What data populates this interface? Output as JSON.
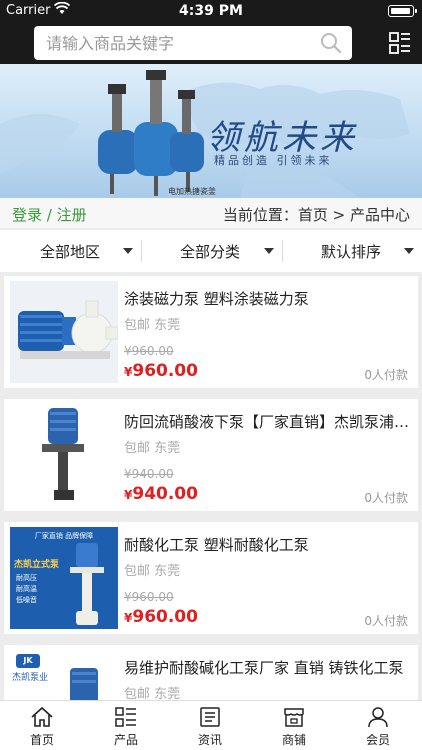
{
  "status_bar": {
    "carrier": "Carrier",
    "time": "4:39 PM"
  },
  "search": {
    "placeholder": "请输入商品关键字"
  },
  "banner": {
    "slogan": "领航未来",
    "subtitle": "精品创造 引领未来",
    "brand_text": "电加热搪瓷釜"
  },
  "crumbs": {
    "login": "登录 / 注册",
    "position": "当前位置：首页 > 产品中心"
  },
  "filters": [
    {
      "label": "全部地区"
    },
    {
      "label": "全部分类"
    },
    {
      "label": "默认排序"
    }
  ],
  "products": [
    {
      "title": "涂装磁力泵 塑料涂装磁力泵",
      "meta": "包邮 东莞",
      "old_price": "¥960.00",
      "currency": "¥",
      "price": "960.00",
      "paid": "0人付款"
    },
    {
      "title": "防回流硝酸液下泵【厂家直销】杰凯泵浦立式泵",
      "meta": "包邮 东莞",
      "old_price": "¥940.00",
      "currency": "¥",
      "price": "940.00",
      "paid": "0人付款"
    },
    {
      "title": "耐酸化工泵 塑料耐酸化工泵",
      "meta": "包邮 东莞",
      "old_price": "¥960.00",
      "currency": "¥",
      "price": "960.00",
      "paid": "0人付款",
      "image_text": {
        "top": "厂家直销 品牌保障",
        "heading": "杰凯立式泵",
        "lines": [
          "耐高压",
          "耐高温",
          "低噪音"
        ]
      }
    },
    {
      "title": "易维护耐酸碱化工泵厂家 直销 铸铁化工泵",
      "meta": "包邮 东莞",
      "image_text": {
        "brand": "杰凯泵业"
      }
    }
  ],
  "tabs": [
    {
      "label": "首页",
      "icon": "home-icon"
    },
    {
      "label": "产品",
      "icon": "list-icon"
    },
    {
      "label": "资讯",
      "icon": "news-icon"
    },
    {
      "label": "商铺",
      "icon": "shop-icon"
    },
    {
      "label": "会员",
      "icon": "user-icon"
    }
  ],
  "colors": {
    "topbar": "#1a1a1a",
    "accent_green": "#3a9a3a",
    "price_red": "#e02020"
  }
}
